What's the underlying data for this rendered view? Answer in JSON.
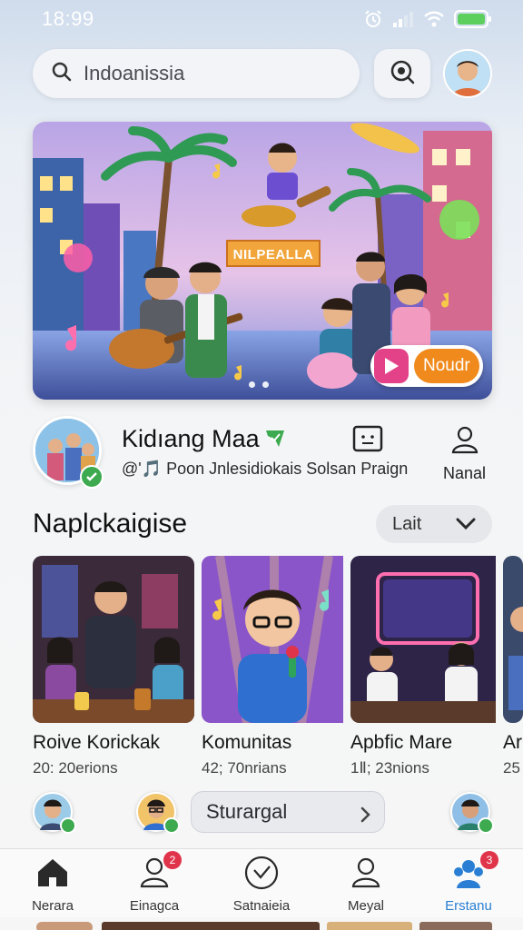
{
  "status": {
    "time": "18:99"
  },
  "search": {
    "placeholder": "Indoanissia"
  },
  "hero": {
    "banner_text": "NILPEALLA",
    "cta_label": "Noudr",
    "slide_count": 2,
    "active_slide": 1
  },
  "profile": {
    "name": "Kidıang Maa",
    "subtitle": "@'🎵 Poon Jnlesidiokais Solsan Praign",
    "action_label": "Nanal"
  },
  "section": {
    "title": "Naplckaigise",
    "sort_label": "Lait"
  },
  "cards": [
    {
      "title": "Roive Korickаk",
      "meta": "20: 20erions"
    },
    {
      "title": "Komunitas",
      "meta": "42; 70nrians"
    },
    {
      "title": "Apbfic Mare",
      "meta": "1Ⅱ; 23nions"
    },
    {
      "title": "Ar",
      "meta": "25"
    }
  ],
  "footer_pill": {
    "label": "Sturargal"
  },
  "tabs": [
    {
      "label": "Nerara",
      "badge": ""
    },
    {
      "label": "Einagca",
      "badge": "2"
    },
    {
      "label": "Satnaieia",
      "badge": ""
    },
    {
      "label": "Meyal",
      "badge": ""
    },
    {
      "label": "Erstanu",
      "badge": "3"
    }
  ],
  "colors": {
    "accent": "#2a7fd4",
    "verified": "#3daa4f",
    "badge": "#e0344a",
    "cta": "#f08a1c"
  }
}
